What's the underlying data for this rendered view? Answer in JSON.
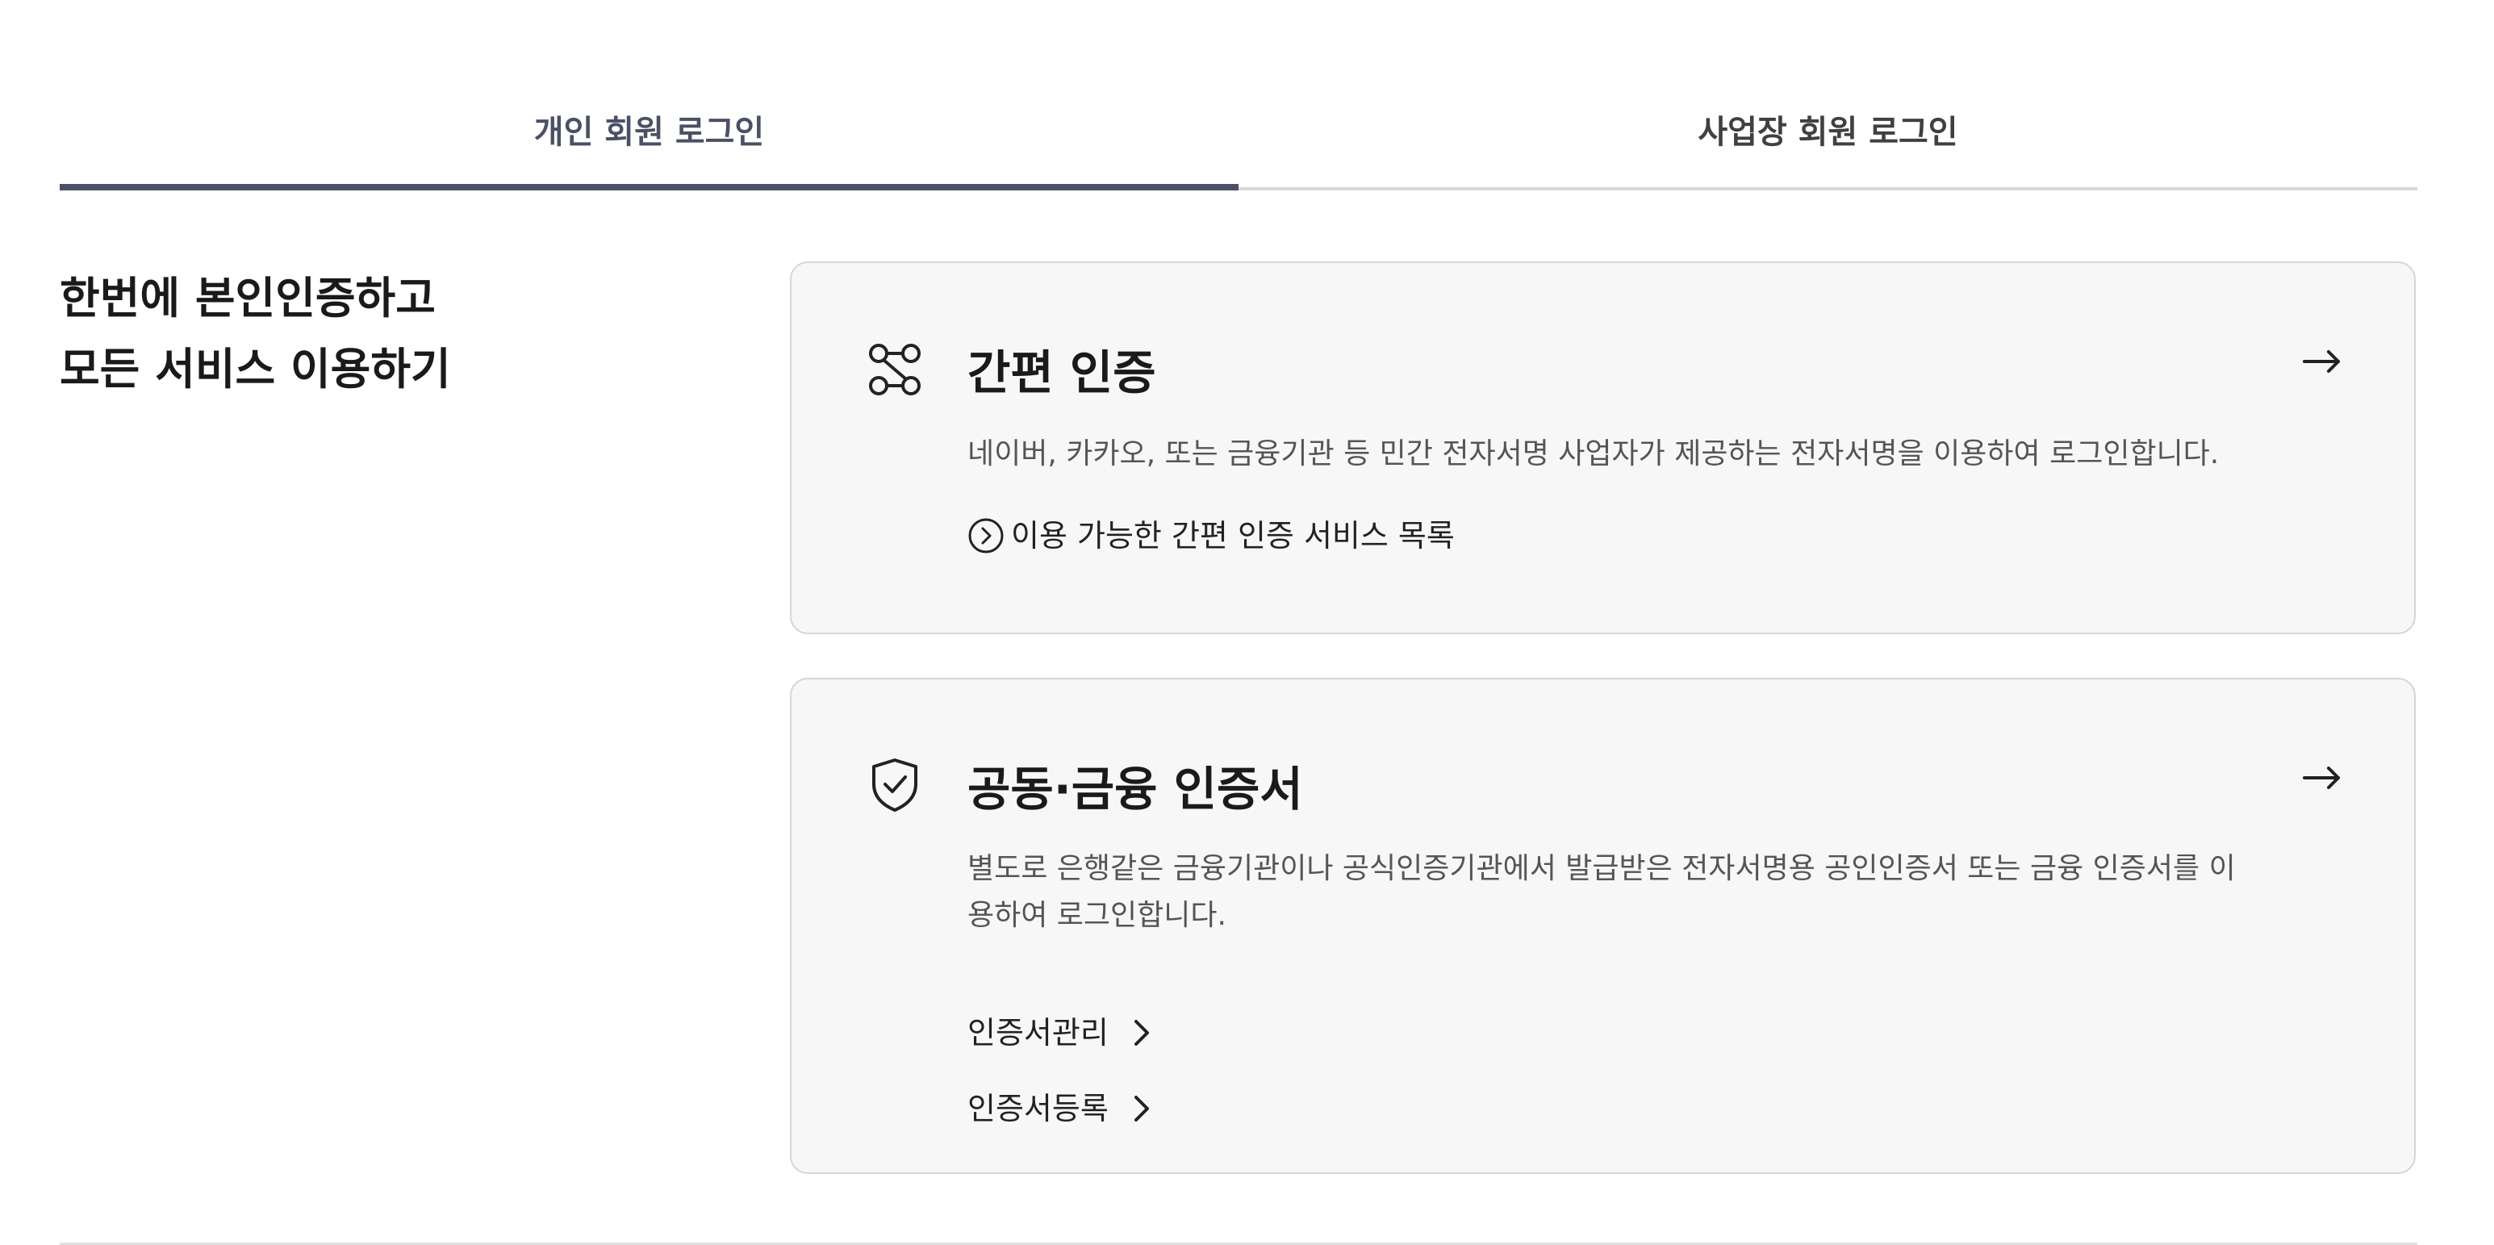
{
  "tabs": [
    {
      "label": "개인 회원 로그인",
      "active": true
    },
    {
      "label": "사업장 회원 로그인",
      "active": false
    }
  ],
  "headline": {
    "line1": "한번에 본인인증하고",
    "line2": "모든 서비스 이용하기"
  },
  "simple_auth": {
    "icon": "link-nodes-icon",
    "title": "간편 인증",
    "description": "네이버, 카카오, 또는 금융기관 등 민간 전자서명 사업자가 제공하는 전자서명을 이용하여 로그인합니다.",
    "link_label": "이용 가능한 간편 인증 서비스 목록"
  },
  "certificate": {
    "icon": "shield-check-icon",
    "title": "공동·금융 인증서",
    "description": "별도로 은행같은 금융기관이나 공식인증기관에서 발급받은 전자서명용 공인인증서 또는 금융 인증서를 이용하여 로그인합니다.",
    "manage_label": "인증서관리",
    "register_label": "인증서등록"
  },
  "colors": {
    "accent": "#4b5064",
    "card_bg": "#f7f7f7",
    "card_border": "#d6d6d6"
  }
}
